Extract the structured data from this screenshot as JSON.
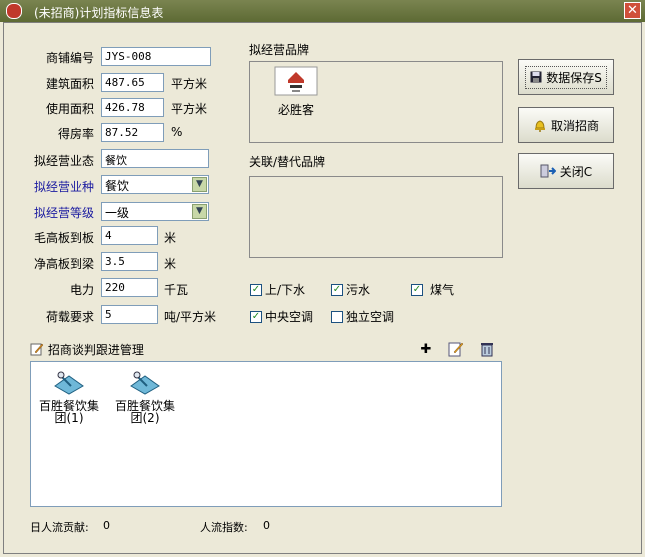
{
  "window": {
    "title": "(未招商)计划指标信息表",
    "close_glyph": "✕"
  },
  "fields": {
    "shop_no": {
      "label": "商铺编号",
      "value": "JYS-008"
    },
    "building_area": {
      "label": "建筑面积",
      "value": "487.65",
      "unit": "平方米"
    },
    "usable_area": {
      "label": "使用面积",
      "value": "426.78",
      "unit": "平方米"
    },
    "efficiency": {
      "label": "得房率",
      "value": "87.52",
      "unit": "%"
    },
    "format": {
      "label": "拟经营业态",
      "value": "餐饮"
    },
    "category": {
      "label": "拟经营业种",
      "value": "餐饮"
    },
    "grade": {
      "label": "拟经营等级",
      "value": "一级"
    },
    "gross_height": {
      "label": "毛高板到板",
      "value": "4",
      "unit": "米"
    },
    "net_height": {
      "label": "净高板到梁",
      "value": "3.5",
      "unit": "米"
    },
    "power": {
      "label": "电力",
      "value": "220",
      "unit": "千瓦"
    },
    "load": {
      "label": "荷载要求",
      "value": "5",
      "unit": "吨/平方米"
    }
  },
  "brand_section": {
    "label": "拟经营品牌",
    "brand_name": "必胜客"
  },
  "related_section": {
    "label": "关联/替代品牌"
  },
  "checkboxes": [
    {
      "label": "上/下水",
      "checked": true
    },
    {
      "label": "污水",
      "checked": true
    },
    {
      "label": "煤气",
      "checked": true
    },
    {
      "label": "中央空调",
      "checked": true
    },
    {
      "label": "独立空调",
      "checked": false
    }
  ],
  "buttons": {
    "save": "数据保存S",
    "cancel": "取消招商",
    "close": "关闭C"
  },
  "negotiation": {
    "title": "招商谈判跟进管理",
    "items": [
      {
        "line1": "百胜餐饮集",
        "line2": "团(1)"
      },
      {
        "line1": "百胜餐饮集",
        "line2": "团(2)"
      }
    ]
  },
  "status": {
    "daily_flow_label": "日人流贡献:",
    "daily_flow_value": "0",
    "flow_index_label": "人流指数:",
    "flow_index_value": "0"
  },
  "colors": {
    "title_bar": "#6b7540",
    "label_blue": "#1a1aa0",
    "check_green": "#218a21"
  }
}
